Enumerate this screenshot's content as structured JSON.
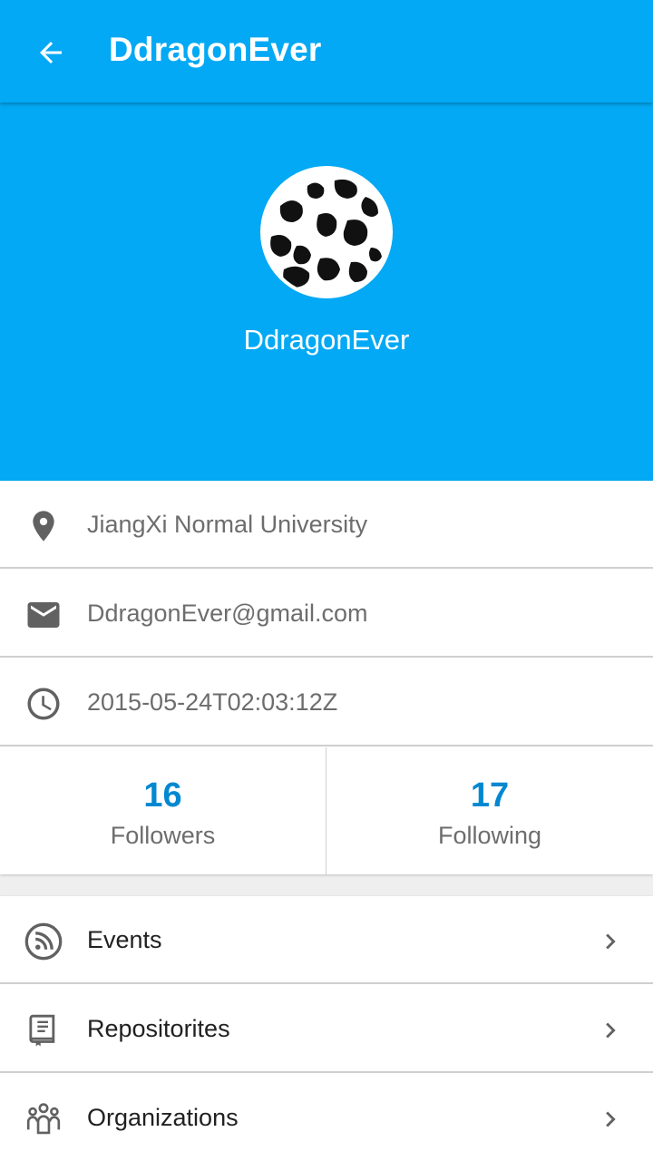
{
  "appbar": {
    "title": "DdragonEver",
    "back_icon": "arrow-left-icon"
  },
  "profile": {
    "name": "DdragonEver",
    "avatar": "cow-pattern-avatar"
  },
  "info": {
    "location": "JiangXi Normal University",
    "email": "DdragonEver@gmail.com",
    "created_at": "2015-05-24T02:03:12Z"
  },
  "stats": {
    "followers": {
      "count": "16",
      "label": "Followers"
    },
    "following": {
      "count": "17",
      "label": "Following"
    }
  },
  "menu": [
    {
      "label": "Events",
      "icon": "rss-icon"
    },
    {
      "label": "Repositorites",
      "icon": "book-icon"
    },
    {
      "label": "Organizations",
      "icon": "group-icon"
    }
  ],
  "colors": {
    "primary": "#03a9f4",
    "accent_number": "#0288d1",
    "icon_gray": "#616161"
  }
}
